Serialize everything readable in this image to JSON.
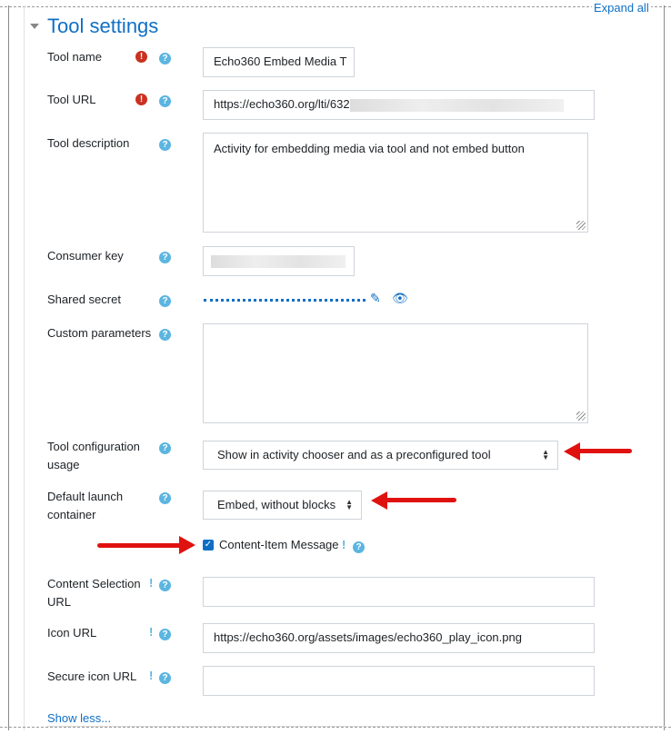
{
  "header": {
    "expand_all": "Expand all",
    "title": "Tool settings"
  },
  "fields": {
    "tool_name": {
      "label": "Tool name",
      "value": "Echo360 Embed Media T"
    },
    "tool_url": {
      "label": "Tool URL",
      "value": "https://echo360.org/lti/632"
    },
    "tool_description": {
      "label": "Tool description",
      "value": "Activity for embedding media via tool and not embed button"
    },
    "consumer_key": {
      "label": "Consumer key",
      "value": ""
    },
    "shared_secret": {
      "label": "Shared secret"
    },
    "custom_parameters": {
      "label": "Custom parameters",
      "value": ""
    },
    "tool_config_usage": {
      "label": "Tool configuration usage",
      "value": "Show in activity chooser and as a preconfigured tool"
    },
    "default_launch": {
      "label": "Default launch container",
      "value": "Embed, without blocks"
    },
    "content_item": {
      "label": "Content-Item Message",
      "checked": true
    },
    "content_selection_url": {
      "label": "Content Selection URL",
      "value": ""
    },
    "icon_url": {
      "label": "Icon URL",
      "value": "https://echo360.org/assets/images/echo360_play_icon.png"
    },
    "secure_icon_url": {
      "label": "Secure icon URL",
      "value": ""
    }
  },
  "icons": {
    "required": "!",
    "help": "?",
    "advanced": "!"
  },
  "footer": {
    "show_less": "Show less..."
  },
  "colors": {
    "accent": "#0f6fc5",
    "annotation_arrow": "#e0120f",
    "required": "#ca3120",
    "help": "#5bb5e0"
  }
}
